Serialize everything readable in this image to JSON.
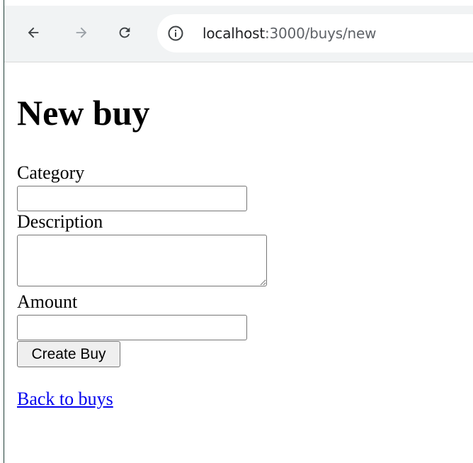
{
  "browser": {
    "url_host": "localhost",
    "url_rest": ":3000/buys/new",
    "icons": {
      "back": "arrow-left-icon",
      "forward": "arrow-right-icon",
      "reload": "reload-icon",
      "site_info": "info-icon"
    }
  },
  "page": {
    "title": "New buy"
  },
  "form": {
    "category_label": "Category",
    "category_value": "",
    "description_label": "Description",
    "description_value": "",
    "amount_label": "Amount",
    "amount_value": "",
    "submit_label": "Create Buy"
  },
  "links": {
    "back_label": "Back to buys"
  },
  "colors": {
    "link": "#0000ee",
    "toolbar_bg": "#f1f3f4",
    "button_bg": "#efefef"
  }
}
